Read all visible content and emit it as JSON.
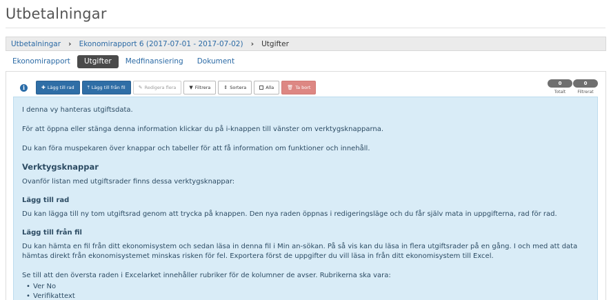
{
  "page": {
    "title": "Utbetalningar"
  },
  "breadcrumb": {
    "items": [
      "Utbetalningar",
      "Ekonomirapport 6 (2017-07-01 - 2017-07-02)",
      "Utgifter"
    ],
    "separator": "›"
  },
  "tabs": [
    {
      "label": "Ekonomirapport",
      "active": false
    },
    {
      "label": "Utgifter",
      "active": true
    },
    {
      "label": "Medfinansiering",
      "active": false
    },
    {
      "label": "Dokument",
      "active": false
    }
  ],
  "toolbar": {
    "info_icon": "info-circle-icon",
    "buttons": {
      "add_row": "Lägg till rad",
      "add_from_file": "Lägg till från fil",
      "edit_multiple": "Redigera flera",
      "filter": "Filtrera",
      "sort": "Sortera",
      "all": "Alla",
      "delete": "Ta bort"
    }
  },
  "counters": {
    "total": {
      "value": "0",
      "label": "Totalt"
    },
    "filtered": {
      "value": "0",
      "label": "Filtrerat"
    }
  },
  "info": {
    "p1": "I denna vy hanteras utgiftsdata.",
    "p2": "För att öppna eller stänga denna information klickar du på i-knappen till vänster om verktygsknapparna.",
    "p3": "Du kan föra muspekaren över knappar och tabeller för att få information om funktioner och innehåll.",
    "heading": "Verktygsknappar",
    "p4": "Ovanför listan med utgiftsrader finns dessa verktygsknappar:",
    "sub1": "Lägg till rad",
    "p5": "Du kan lägga till ny tom utgiftsrad genom att trycka på knappen. Den nya raden öppnas i redigeringsläge och du får själv mata in uppgifterna, rad för rad.",
    "sub2": "Lägg till från fil",
    "p6": "Du kan hämta en fil från ditt ekonomisystem och sedan läsa in denna fil i Min an-sökan. På så vis kan du läsa in flera utgiftsrader på en gång. I och med att data hämtas direkt från ekonomisystemet minskas risken för fel. Exportera först de uppgifter du vill läsa in från ditt ekonomisystem till Excel.",
    "p7": "Se till att den översta raden i Excelarket innehåller rubriker för de kolumner de avser. Rubrikerna ska vara:",
    "list": [
      "Ver No",
      "Verifikattext"
    ]
  },
  "colors": {
    "link": "#2b6aa5",
    "primary": "#2f6ea6",
    "danger": "#dd8783",
    "info_bg": "#d9ecf7",
    "active_tab": "#4a4a4a"
  }
}
